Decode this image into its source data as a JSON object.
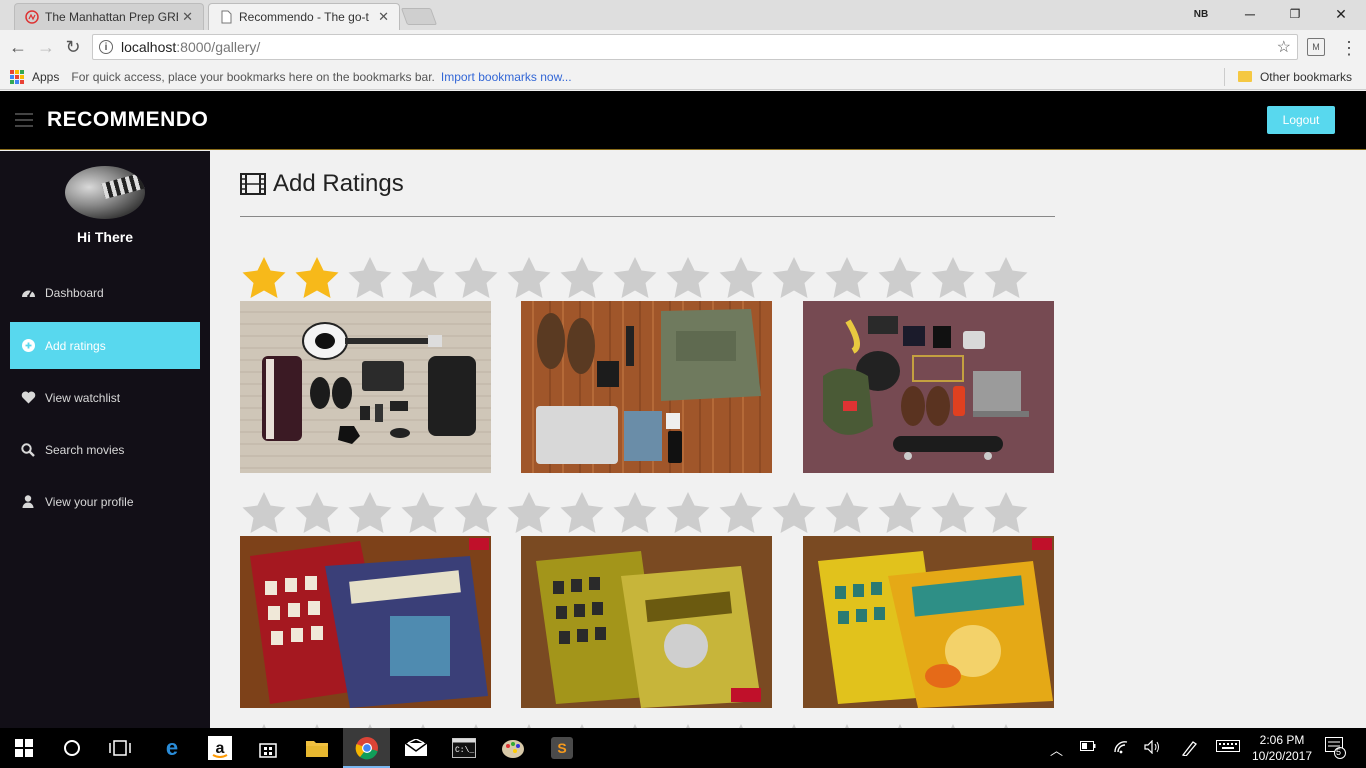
{
  "browser": {
    "tabs": [
      {
        "title": "The Manhattan Prep GRE",
        "active": false
      },
      {
        "title": "Recommendo - The go-t",
        "active": true
      }
    ],
    "url_host": "localhost",
    "url_path": ":8000/gallery/",
    "bookmarks": {
      "apps_label": "Apps",
      "hint": "For quick access, place your bookmarks here on the bookmarks bar.",
      "import_link": "Import bookmarks now...",
      "other_label": "Other bookmarks"
    },
    "ext_label": "NB"
  },
  "app": {
    "brand": "RECOMMENDO",
    "logout_label": "Logout",
    "greeting": "Hi There",
    "nav": [
      {
        "label": "Dashboard",
        "icon": "dashboard-icon"
      },
      {
        "label": "Add ratings",
        "icon": "plus-circle-icon",
        "active": true
      },
      {
        "label": "View watchlist",
        "icon": "heart-icon"
      },
      {
        "label": "Search movies",
        "icon": "search-icon"
      },
      {
        "label": "View your profile",
        "icon": "user-icon"
      }
    ],
    "page_title": "Add Ratings",
    "rows": [
      {
        "rating": 2,
        "max": 15,
        "items": [
          "flatlay-guitar",
          "flatlay-laptop-bag",
          "flatlay-skateboard"
        ]
      },
      {
        "rating": 0,
        "max": 15,
        "items": [
          "book-cash-free",
          "book-storefront",
          "book-marketing"
        ]
      }
    ],
    "colors": {
      "accent": "#58d8ee",
      "star_on": "#f7b91a",
      "star_off": "#cdcdcd",
      "sidebar": "#120f17"
    }
  },
  "taskbar": {
    "time": "2:06 PM",
    "date": "10/20/2017",
    "notification_count": "5"
  }
}
